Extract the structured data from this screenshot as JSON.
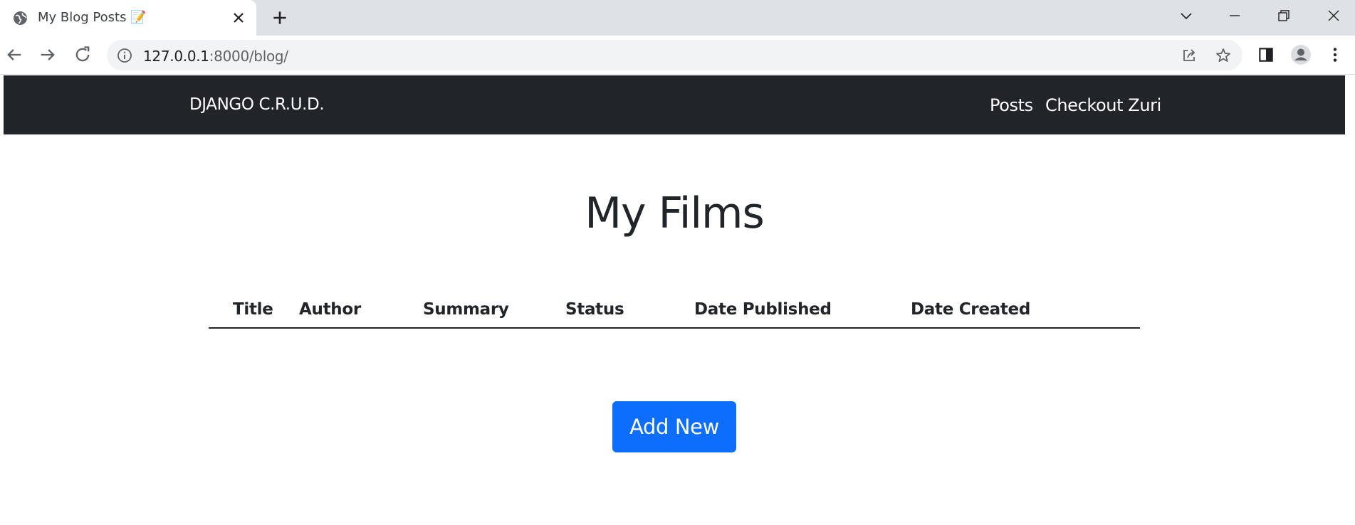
{
  "browser": {
    "tab": {
      "title": "My Blog Posts 📝",
      "favicon": "globe-icon",
      "close": "close-icon"
    },
    "new_tab": "plus-icon",
    "window_controls": [
      "chevron-down-icon",
      "minimize-icon",
      "restore-icon",
      "close-icon"
    ],
    "address_bar": {
      "url_host": "127.0.0.1",
      "url_rest": ":8000/blog/",
      "site_info": "info-icon",
      "share": "share-icon",
      "bookmark": "star-icon"
    },
    "nav": [
      "back-arrow-icon",
      "forward-arrow-icon",
      "reload-icon"
    ],
    "toolbar_right": [
      "side-panel-icon",
      "profile-avatar-icon",
      "kebab-menu-icon"
    ]
  },
  "navbar": {
    "brand": "DJANGO C.R.U.D.",
    "links": [
      {
        "label": "Posts"
      },
      {
        "label": "Checkout Zuri"
      }
    ],
    "background": "#212529"
  },
  "main": {
    "title": "My Films",
    "table": {
      "columns": [
        "Title",
        "Author",
        "Summary",
        "Status",
        "Date Published",
        "Date Created"
      ],
      "rows": []
    },
    "add_button": {
      "label": "Add New",
      "color": "#0d6efd"
    }
  }
}
